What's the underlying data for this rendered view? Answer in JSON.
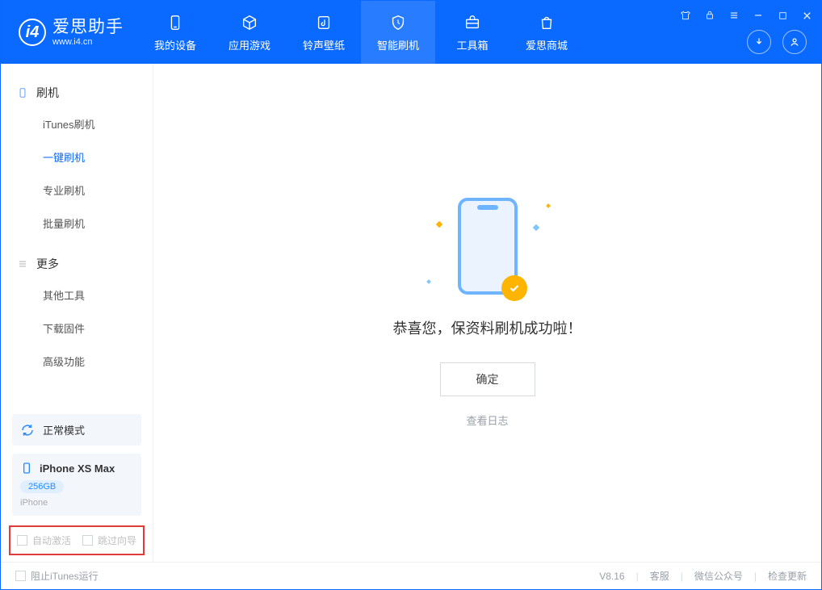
{
  "app": {
    "title": "爱思助手",
    "subtitle": "www.i4.cn"
  },
  "topnav": [
    {
      "label": "我的设备",
      "icon": "device"
    },
    {
      "label": "应用游戏",
      "icon": "cube"
    },
    {
      "label": "铃声壁纸",
      "icon": "music"
    },
    {
      "label": "智能刷机",
      "icon": "shield",
      "active": true
    },
    {
      "label": "工具箱",
      "icon": "toolbox"
    },
    {
      "label": "爱思商城",
      "icon": "bag"
    }
  ],
  "sidebar": {
    "sections": [
      {
        "title": "刷机",
        "icon": "phone",
        "items": [
          {
            "label": "iTunes刷机"
          },
          {
            "label": "一键刷机",
            "active": true
          },
          {
            "label": "专业刷机"
          },
          {
            "label": "批量刷机"
          }
        ]
      },
      {
        "title": "更多",
        "icon": "menu",
        "items": [
          {
            "label": "其他工具"
          },
          {
            "label": "下载固件"
          },
          {
            "label": "高级功能"
          }
        ]
      }
    ],
    "mode": {
      "label": "正常模式"
    },
    "device": {
      "name": "iPhone XS Max",
      "storage": "256GB",
      "type": "iPhone"
    },
    "checkboxes": {
      "auto_activate": "自动激活",
      "skip_guide": "跳过向导"
    }
  },
  "main": {
    "message": "恭喜您，保资料刷机成功啦！",
    "ok_button": "确定",
    "log_link": "查看日志"
  },
  "footer": {
    "block_itunes": "阻止iTunes运行",
    "version": "V8.16",
    "links": [
      "客服",
      "微信公众号",
      "检查更新"
    ]
  }
}
